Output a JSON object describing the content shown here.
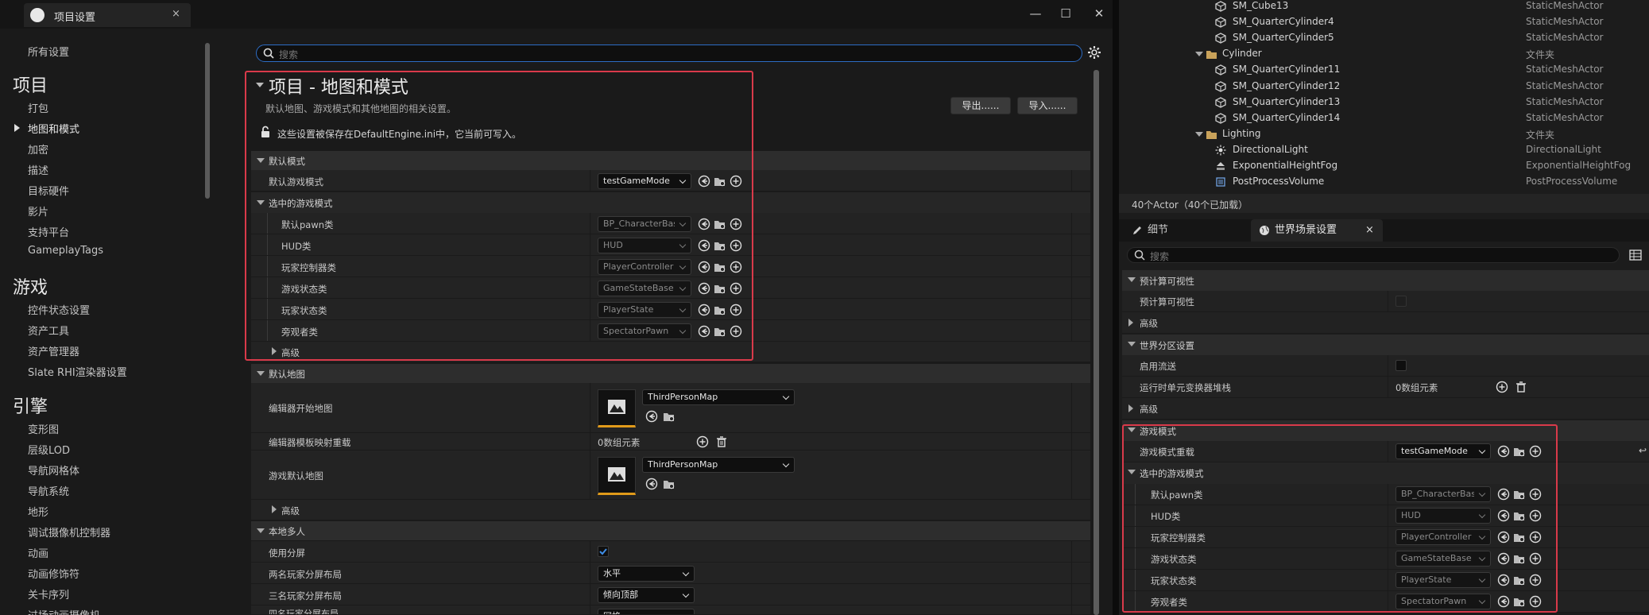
{
  "window": {
    "tab_title": "项目设置",
    "tab_close": "×",
    "min": "—",
    "max": "☐",
    "close": "✕"
  },
  "sidebar": {
    "all_settings": "所有设置",
    "sections": [
      {
        "title": "项目",
        "items": [
          "打包",
          "地图和模式",
          "加密",
          "描述",
          "目标硬件",
          "影片",
          "支持平台",
          "GameplayTags"
        ]
      },
      {
        "title": "游戏",
        "items": [
          "控件状态设置",
          "资产工具",
          "资产管理器",
          "Slate RHI渲染器设置"
        ]
      },
      {
        "title": "引擎",
        "items": [
          "变形图",
          "层级LOD",
          "导航网格体",
          "导航系统",
          "地形",
          "调试摄像机控制器",
          "动画",
          "动画修饰符",
          "关卡序列",
          "过场动画摄像机"
        ]
      }
    ],
    "active_item": "地图和模式"
  },
  "main": {
    "search_placeholder": "搜索",
    "title": "项目 - 地图和模式",
    "description": "默认地图、游戏模式和其他地图的相关设置。",
    "lock_note": "这些设置被保存在DefaultEngine.ini中，它当前可写入。",
    "export_label": "导出......",
    "import_label": "导入......",
    "default_modes": {
      "header": "默认模式",
      "game_mode_label": "默认游戏模式",
      "game_mode_value": "testGameMode",
      "selected_header": "选中的游戏模式",
      "rows": [
        {
          "label": "默认pawn类",
          "value": "BP_CharacterBase"
        },
        {
          "label": "HUD类",
          "value": "HUD"
        },
        {
          "label": "玩家控制器类",
          "value": "PlayerController"
        },
        {
          "label": "游戏状态类",
          "value": "GameStateBase"
        },
        {
          "label": "玩家状态类",
          "value": "PlayerState"
        },
        {
          "label": "旁观者类",
          "value": "SpectatorPawn"
        }
      ],
      "advanced": "高级"
    },
    "default_maps": {
      "header": "默认地图",
      "editor_start_label": "编辑器开始地图",
      "editor_start_value": "ThirdPersonMap",
      "template_override_label": "编辑器模板映射重载",
      "template_override_value": "0数组元素",
      "game_default_label": "游戏默认地图",
      "game_default_value": "ThirdPersonMap",
      "advanced": "高级"
    },
    "local_multiplayer": {
      "header": "本地多人",
      "split_screen_label": "使用分屏",
      "two_player_label": "两名玩家分屏布局",
      "two_player_value": "水平",
      "three_player_label": "三名玩家分屏布局",
      "three_player_value": "倾向顶部",
      "four_player_label": "四名玩家分屏布局",
      "four_player_value": "网格"
    }
  },
  "outliner": {
    "rows": [
      {
        "name": "SM_Cube13",
        "type": "StaticMeshActor",
        "kind": "mesh",
        "depth": 2
      },
      {
        "name": "SM_QuarterCylinder4",
        "type": "StaticMeshActor",
        "kind": "mesh",
        "depth": 2
      },
      {
        "name": "SM_QuarterCylinder5",
        "type": "StaticMeshActor",
        "kind": "mesh",
        "depth": 2
      },
      {
        "name": "Cylinder",
        "type": "文件夹",
        "kind": "folder",
        "depth": 1
      },
      {
        "name": "SM_QuarterCylinder11",
        "type": "StaticMeshActor",
        "kind": "mesh",
        "depth": 2
      },
      {
        "name": "SM_QuarterCylinder12",
        "type": "StaticMeshActor",
        "kind": "mesh",
        "depth": 2
      },
      {
        "name": "SM_QuarterCylinder13",
        "type": "StaticMeshActor",
        "kind": "mesh",
        "depth": 2
      },
      {
        "name": "SM_QuarterCylinder14",
        "type": "StaticMeshActor",
        "kind": "mesh",
        "depth": 2
      },
      {
        "name": "Lighting",
        "type": "文件夹",
        "kind": "folder",
        "depth": 1
      },
      {
        "name": "DirectionalLight",
        "type": "DirectionalLight",
        "kind": "light",
        "depth": 2
      },
      {
        "name": "ExponentialHeightFog",
        "type": "ExponentialHeightFog",
        "kind": "fog",
        "depth": 2
      },
      {
        "name": "PostProcessVolume",
        "type": "PostProcessVolume",
        "kind": "volume",
        "depth": 2
      }
    ],
    "count": "40个Actor（40个已加载）"
  },
  "details": {
    "tab_details": "细节",
    "tab_world": "世界场景设置",
    "search_placeholder": "搜索",
    "precomputed_header": "预计算可视性",
    "precomputed_label": "预计算可视性",
    "advanced": "高级",
    "world_partition_header": "世界分区设置",
    "enable_streaming_label": "启用流送",
    "runtime_stack_label": "运行时单元变换器堆栈",
    "runtime_stack_value": "0数组元素",
    "game_mode_header": "游戏模式",
    "override_label": "游戏模式重载",
    "override_value": "testGameMode",
    "selected_header": "选中的游戏模式",
    "rows": [
      {
        "label": "默认pawn类",
        "value": "BP_CharacterBase"
      },
      {
        "label": "HUD类",
        "value": "HUD"
      },
      {
        "label": "玩家控制器类",
        "value": "PlayerController"
      },
      {
        "label": "游戏状态类",
        "value": "GameStateBase"
      },
      {
        "label": "玩家状态类",
        "value": "PlayerState"
      },
      {
        "label": "旁观者类",
        "value": "SpectatorPawn"
      }
    ]
  },
  "colors": {
    "highlight_box": "#d93a4a",
    "search_focus": "#2d6cc4",
    "map_thumb_accent": "#e09a1a",
    "folder": "#c9a25a"
  }
}
